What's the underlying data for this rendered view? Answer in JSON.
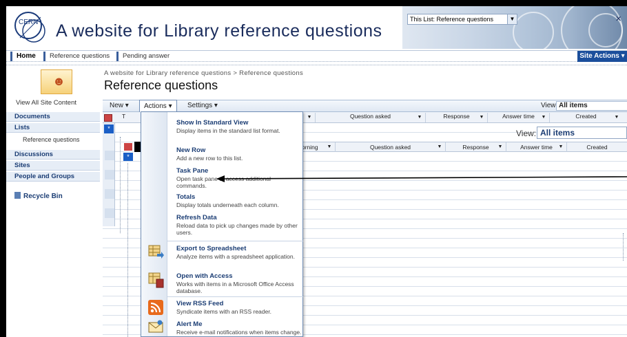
{
  "header": {
    "logo_text": "CERN",
    "site_title": "A website for Library reference questions",
    "search_scope": "This List: Reference questions"
  },
  "topnav": {
    "home": "Home",
    "reference": "Reference questions",
    "pending": "Pending answer",
    "site_actions": "Site Actions ▾"
  },
  "page": {
    "breadcrumb": "A website for Library reference questions > Reference questions",
    "title": "Reference questions"
  },
  "leftnav": {
    "view_all": "View All Site Content",
    "documents": "Documents",
    "lists": "Lists",
    "lists_sub": "Reference questions",
    "discussions": "Discussions",
    "sites": "Sites",
    "people": "People and Groups",
    "recycle": "Recycle Bin"
  },
  "toolbar": {
    "new": "New ▾",
    "actions": "Actions ▾",
    "settings": "Settings ▾",
    "view_label": "View:",
    "view_value": "All items"
  },
  "sheet": {
    "top_columns": [
      "Question asked",
      "Response",
      "Answer time",
      "Created"
    ],
    "first_col_fragment": "T",
    "view_label": "View:",
    "view_value": "All items",
    "inner_columns": [
      "orning",
      "Question asked",
      "Response",
      "Answer time",
      "Created"
    ]
  },
  "menu": {
    "items": [
      {
        "title": "Show In Standard View",
        "desc": "Display items in the standard list format."
      },
      {
        "title": "New Row",
        "desc": "Add a new row to this list."
      },
      {
        "title": "Task Pane",
        "desc": "Open task pane to access additional commands."
      },
      {
        "title": "Totals",
        "desc": "Display totals underneath each column."
      },
      {
        "title": "Refresh Data",
        "desc": "Reload data to pick up changes made by other users."
      },
      {
        "title": "Export to Spreadsheet",
        "desc": "Analyze items with a spreadsheet application."
      },
      {
        "title": "Open with Access",
        "desc": "Works with items in a Microsoft Office Access database."
      },
      {
        "title": "View RSS Feed",
        "desc": "Syndicate items with an RSS reader."
      },
      {
        "title": "Alert Me",
        "desc": "Receive e-mail notifications when items change."
      }
    ]
  },
  "colors": {
    "brand_blue": "#1b3d74",
    "site_actions_bg": "#1b4e9c",
    "rss_orange": "#e86a1c"
  }
}
